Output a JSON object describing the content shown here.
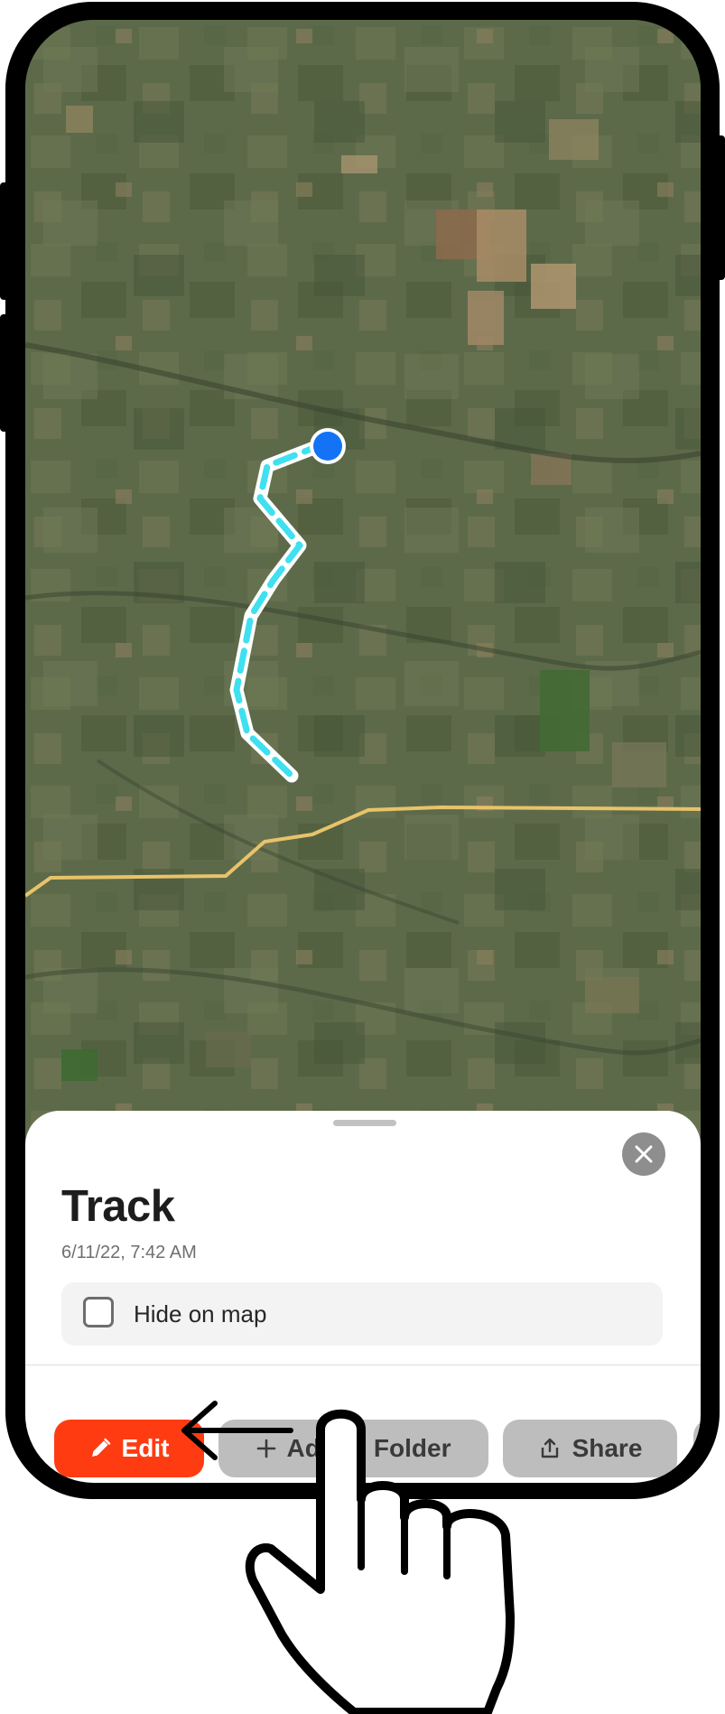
{
  "sheet": {
    "title": "Track",
    "timestamp": "6/11/22, 7:42 AM",
    "hide_on_map_label": "Hide on map",
    "hide_on_map_checked": false
  },
  "actions": {
    "edit_label": "Edit",
    "add_to_folder_label": "Add to Folder",
    "share_label": "Share"
  },
  "icons": {
    "close": "close-icon",
    "edit": "pencil-icon",
    "folder": "plus-icon",
    "share": "share-icon"
  },
  "colors": {
    "edit_button": "#ff3b12",
    "secondary_button": "#bdbdbd",
    "track_line": "#3fe0f0",
    "location_dot": "#1473f5",
    "road": "#e8c36a",
    "map_base": "#5d6a4a"
  },
  "annotation": {
    "gesture": "tap",
    "target": "Edit"
  }
}
